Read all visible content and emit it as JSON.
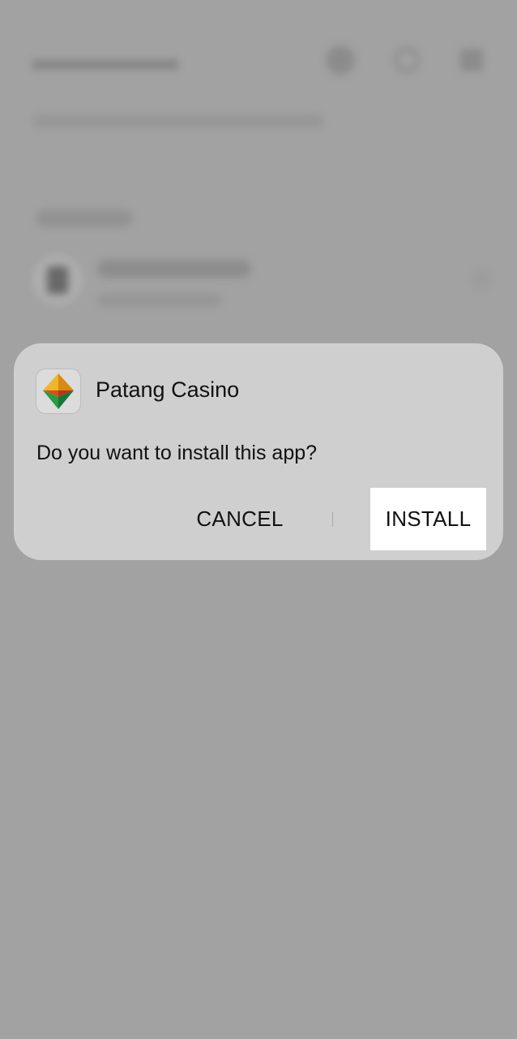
{
  "dialog": {
    "app_name": "Patang Casino",
    "question": "Do you want to install this app?",
    "cancel_label": "CANCEL",
    "install_label": "INSTALL",
    "app_icon": "patang-kite-icon"
  },
  "background_app": {
    "screen": "downloads",
    "state": "blurred",
    "icons": [
      "info-icon",
      "search-icon",
      "more-icon",
      "file-icon",
      "chevron-icon"
    ]
  },
  "colors": {
    "scrim": "#a2a2a2",
    "dialog_bg": "#cfcfcf",
    "install_highlight": "#ffffff",
    "kite_orange": "#e8a020",
    "kite_red": "#c2401a",
    "kite_green": "#1f8a3c"
  }
}
